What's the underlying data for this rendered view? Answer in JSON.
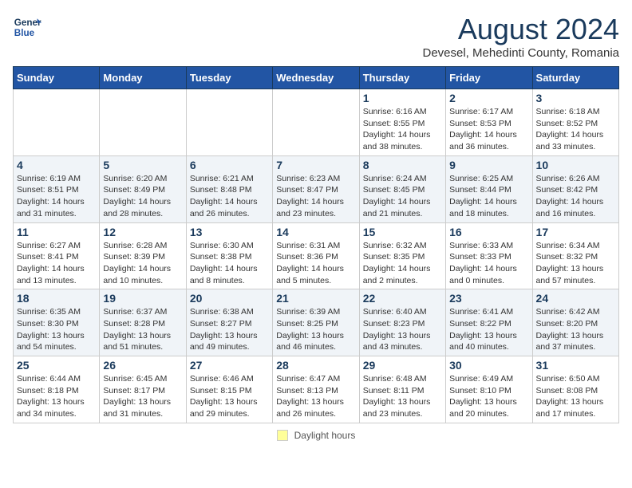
{
  "header": {
    "logo_line1": "General",
    "logo_line2": "Blue",
    "month_title": "August 2024",
    "location": "Devesel, Mehedinti County, Romania"
  },
  "days_of_week": [
    "Sunday",
    "Monday",
    "Tuesday",
    "Wednesday",
    "Thursday",
    "Friday",
    "Saturday"
  ],
  "weeks": [
    [
      {
        "day": "",
        "info": ""
      },
      {
        "day": "",
        "info": ""
      },
      {
        "day": "",
        "info": ""
      },
      {
        "day": "",
        "info": ""
      },
      {
        "day": "1",
        "info": "Sunrise: 6:16 AM\nSunset: 8:55 PM\nDaylight: 14 hours\nand 38 minutes."
      },
      {
        "day": "2",
        "info": "Sunrise: 6:17 AM\nSunset: 8:53 PM\nDaylight: 14 hours\nand 36 minutes."
      },
      {
        "day": "3",
        "info": "Sunrise: 6:18 AM\nSunset: 8:52 PM\nDaylight: 14 hours\nand 33 minutes."
      }
    ],
    [
      {
        "day": "4",
        "info": "Sunrise: 6:19 AM\nSunset: 8:51 PM\nDaylight: 14 hours\nand 31 minutes."
      },
      {
        "day": "5",
        "info": "Sunrise: 6:20 AM\nSunset: 8:49 PM\nDaylight: 14 hours\nand 28 minutes."
      },
      {
        "day": "6",
        "info": "Sunrise: 6:21 AM\nSunset: 8:48 PM\nDaylight: 14 hours\nand 26 minutes."
      },
      {
        "day": "7",
        "info": "Sunrise: 6:23 AM\nSunset: 8:47 PM\nDaylight: 14 hours\nand 23 minutes."
      },
      {
        "day": "8",
        "info": "Sunrise: 6:24 AM\nSunset: 8:45 PM\nDaylight: 14 hours\nand 21 minutes."
      },
      {
        "day": "9",
        "info": "Sunrise: 6:25 AM\nSunset: 8:44 PM\nDaylight: 14 hours\nand 18 minutes."
      },
      {
        "day": "10",
        "info": "Sunrise: 6:26 AM\nSunset: 8:42 PM\nDaylight: 14 hours\nand 16 minutes."
      }
    ],
    [
      {
        "day": "11",
        "info": "Sunrise: 6:27 AM\nSunset: 8:41 PM\nDaylight: 14 hours\nand 13 minutes."
      },
      {
        "day": "12",
        "info": "Sunrise: 6:28 AM\nSunset: 8:39 PM\nDaylight: 14 hours\nand 10 minutes."
      },
      {
        "day": "13",
        "info": "Sunrise: 6:30 AM\nSunset: 8:38 PM\nDaylight: 14 hours\nand 8 minutes."
      },
      {
        "day": "14",
        "info": "Sunrise: 6:31 AM\nSunset: 8:36 PM\nDaylight: 14 hours\nand 5 minutes."
      },
      {
        "day": "15",
        "info": "Sunrise: 6:32 AM\nSunset: 8:35 PM\nDaylight: 14 hours\nand 2 minutes."
      },
      {
        "day": "16",
        "info": "Sunrise: 6:33 AM\nSunset: 8:33 PM\nDaylight: 14 hours\nand 0 minutes."
      },
      {
        "day": "17",
        "info": "Sunrise: 6:34 AM\nSunset: 8:32 PM\nDaylight: 13 hours\nand 57 minutes."
      }
    ],
    [
      {
        "day": "18",
        "info": "Sunrise: 6:35 AM\nSunset: 8:30 PM\nDaylight: 13 hours\nand 54 minutes."
      },
      {
        "day": "19",
        "info": "Sunrise: 6:37 AM\nSunset: 8:28 PM\nDaylight: 13 hours\nand 51 minutes."
      },
      {
        "day": "20",
        "info": "Sunrise: 6:38 AM\nSunset: 8:27 PM\nDaylight: 13 hours\nand 49 minutes."
      },
      {
        "day": "21",
        "info": "Sunrise: 6:39 AM\nSunset: 8:25 PM\nDaylight: 13 hours\nand 46 minutes."
      },
      {
        "day": "22",
        "info": "Sunrise: 6:40 AM\nSunset: 8:23 PM\nDaylight: 13 hours\nand 43 minutes."
      },
      {
        "day": "23",
        "info": "Sunrise: 6:41 AM\nSunset: 8:22 PM\nDaylight: 13 hours\nand 40 minutes."
      },
      {
        "day": "24",
        "info": "Sunrise: 6:42 AM\nSunset: 8:20 PM\nDaylight: 13 hours\nand 37 minutes."
      }
    ],
    [
      {
        "day": "25",
        "info": "Sunrise: 6:44 AM\nSunset: 8:18 PM\nDaylight: 13 hours\nand 34 minutes."
      },
      {
        "day": "26",
        "info": "Sunrise: 6:45 AM\nSunset: 8:17 PM\nDaylight: 13 hours\nand 31 minutes."
      },
      {
        "day": "27",
        "info": "Sunrise: 6:46 AM\nSunset: 8:15 PM\nDaylight: 13 hours\nand 29 minutes."
      },
      {
        "day": "28",
        "info": "Sunrise: 6:47 AM\nSunset: 8:13 PM\nDaylight: 13 hours\nand 26 minutes."
      },
      {
        "day": "29",
        "info": "Sunrise: 6:48 AM\nSunset: 8:11 PM\nDaylight: 13 hours\nand 23 minutes."
      },
      {
        "day": "30",
        "info": "Sunrise: 6:49 AM\nSunset: 8:10 PM\nDaylight: 13 hours\nand 20 minutes."
      },
      {
        "day": "31",
        "info": "Sunrise: 6:50 AM\nSunset: 8:08 PM\nDaylight: 13 hours\nand 17 minutes."
      }
    ]
  ],
  "footer": {
    "legend_label": "Daylight hours"
  }
}
